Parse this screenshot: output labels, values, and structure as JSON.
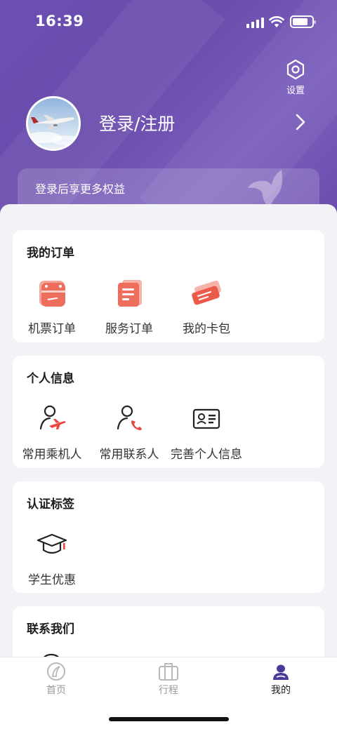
{
  "status_bar": {
    "time": "16:39"
  },
  "header": {
    "settings_label": "设置",
    "login_label": "登录/注册",
    "benefit_text": "登录后享更多权益"
  },
  "sections": {
    "orders": {
      "title": "我的订单",
      "items": [
        {
          "label": "机票订单",
          "icon": "ticket-order-icon"
        },
        {
          "label": "服务订单",
          "icon": "service-order-icon"
        },
        {
          "label": "我的卡包",
          "icon": "card-wallet-icon"
        }
      ]
    },
    "personal": {
      "title": "个人信息",
      "items": [
        {
          "label": "常用乘机人",
          "icon": "passenger-icon"
        },
        {
          "label": "常用联系人",
          "icon": "contact-icon"
        },
        {
          "label": "完善个人信息",
          "icon": "id-card-icon"
        }
      ]
    },
    "certification": {
      "title": "认证标签",
      "items": [
        {
          "label": "学生优惠",
          "icon": "graduation-cap-icon"
        }
      ]
    },
    "contact": {
      "title": "联系我们"
    }
  },
  "tabbar": {
    "tabs": [
      {
        "label": "首页",
        "icon": "home-icon"
      },
      {
        "label": "行程",
        "icon": "luggage-icon"
      },
      {
        "label": "我的",
        "icon": "profile-icon"
      }
    ],
    "active": "我的"
  },
  "colors": {
    "brand_purple": "#6b4fb0",
    "accent_red": "#e8463f",
    "background": "#f1f3f6"
  }
}
